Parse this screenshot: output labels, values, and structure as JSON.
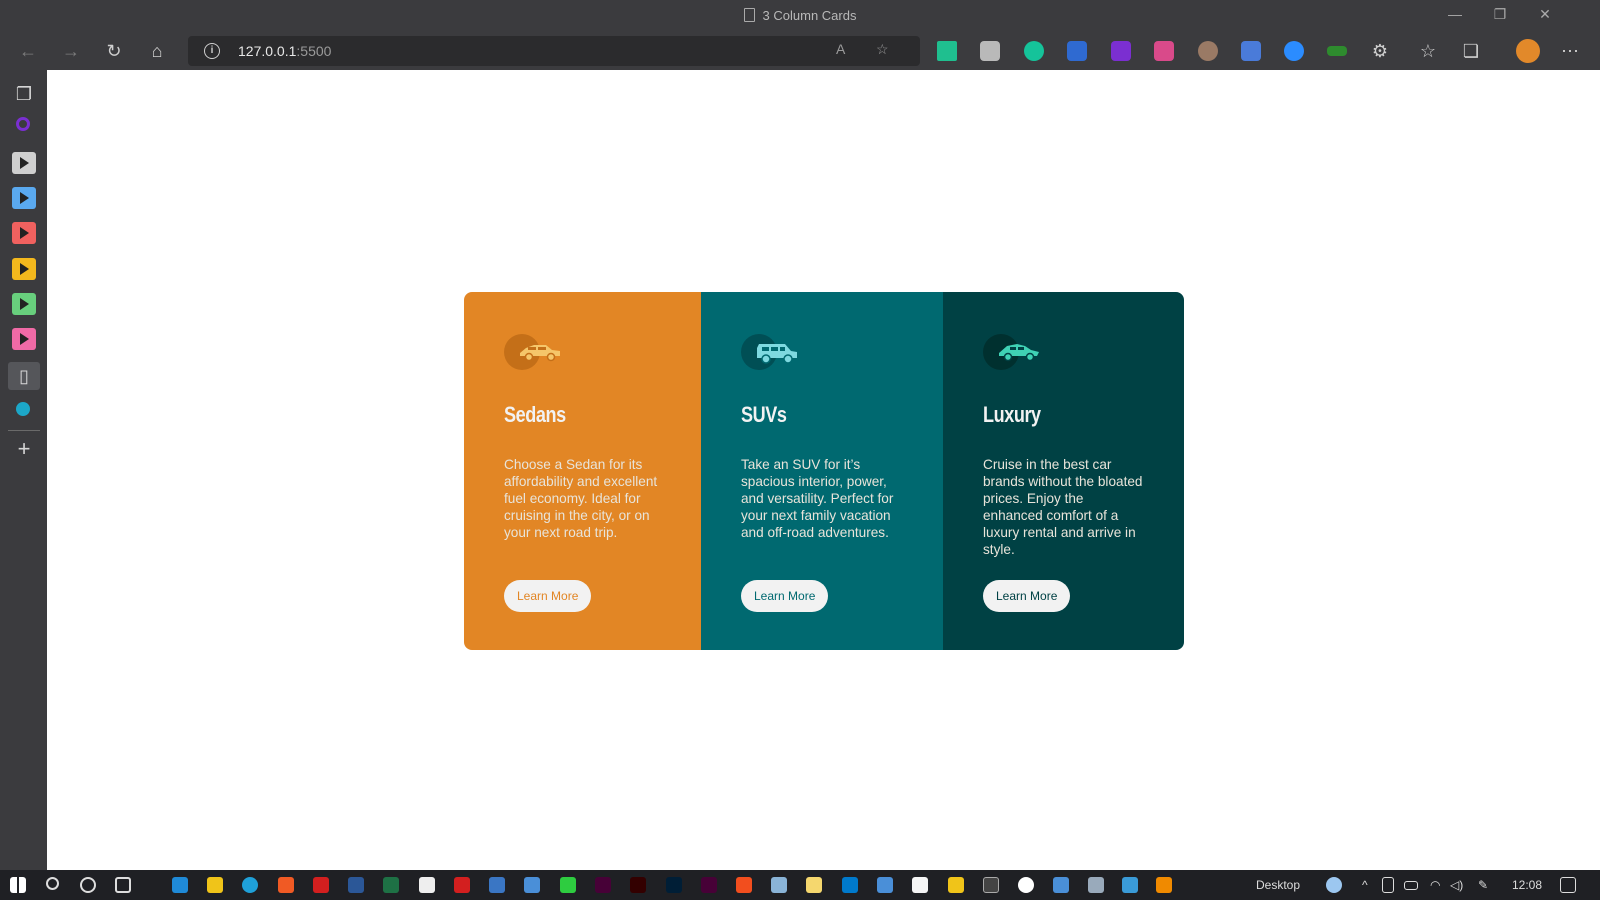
{
  "window": {
    "title": "3 Column Cards"
  },
  "toolbar": {
    "url_host": "127.0.0.1",
    "url_port": ":5500"
  },
  "cards": [
    {
      "title": "Sedans",
      "description": "Choose a Sedan for its affordability and excellent fuel economy. Ideal for cruising in the city, or on your next road trip.",
      "button": "Learn More",
      "icon": "sedan-car-icon",
      "color": "#e28625"
    },
    {
      "title": "SUVs",
      "description": "Take an SUV for it’s spacious interior, power, and versatility. Perfect for your next family vacation and off-road adventures.",
      "button": "Learn More",
      "icon": "suv-car-icon",
      "color": "#006970"
    },
    {
      "title": "Luxury",
      "description": "Cruise in the best car brands without the bloated prices. Enjoy the enhanced comfort of a luxury rental and arrive in style.",
      "button": "Learn More",
      "icon": "luxury-car-icon",
      "color": "#004144"
    }
  ],
  "taskbar": {
    "desktop_label": "Desktop",
    "clock": "12:08"
  }
}
